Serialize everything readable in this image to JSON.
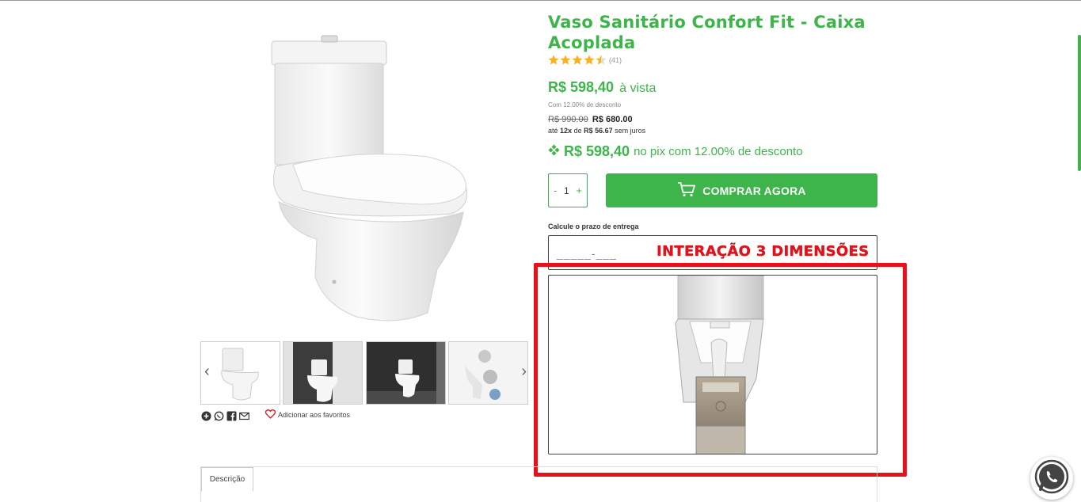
{
  "product": {
    "title": "Vaso Sanitário Confort Fit - Caixa Acoplada",
    "rating_stars": 4.5,
    "rating_count": "(41)"
  },
  "pricing": {
    "main_price": "R$ 598,40",
    "main_suffix": "à vista",
    "discount_note": "Com 12.00% de desconto",
    "old_price": "R$ 990.00",
    "new_price": "R$ 680.00",
    "installments_prefix": "até",
    "installments_count": "12x",
    "installments_mid": "de",
    "installments_value": "R$ 56.67",
    "installments_suffix": "sem juros",
    "pix_price": "R$ 598,40",
    "pix_text": "no pix com 12.00% de desconto"
  },
  "purchase": {
    "qty_minus": "-",
    "qty_value": "1",
    "qty_plus": "+",
    "buy_label": "COMPRAR AGORA"
  },
  "shipping": {
    "label": "Calcule o prazo de entrega",
    "cep_mask": "_____-___"
  },
  "annotation": {
    "label": "INTERAÇÃO 3 DIMENSÕES"
  },
  "gallery": {
    "prev_arrow": "‹",
    "next_arrow": "›"
  },
  "actions": {
    "favorite_label": "Adicionar aos favoritos"
  },
  "tabs": {
    "description": "Descrição"
  },
  "colors": {
    "brand_green": "#3db54a",
    "annotation_red": "#e8111b",
    "star_gold": "#f5b223"
  },
  "icons": [
    "plus-circle-icon",
    "whatsapp-icon",
    "facebook-icon",
    "mail-icon",
    "heart-icon",
    "cart-icon",
    "pix-icon",
    "star-icon",
    "chevron-left-icon",
    "chevron-right-icon"
  ]
}
